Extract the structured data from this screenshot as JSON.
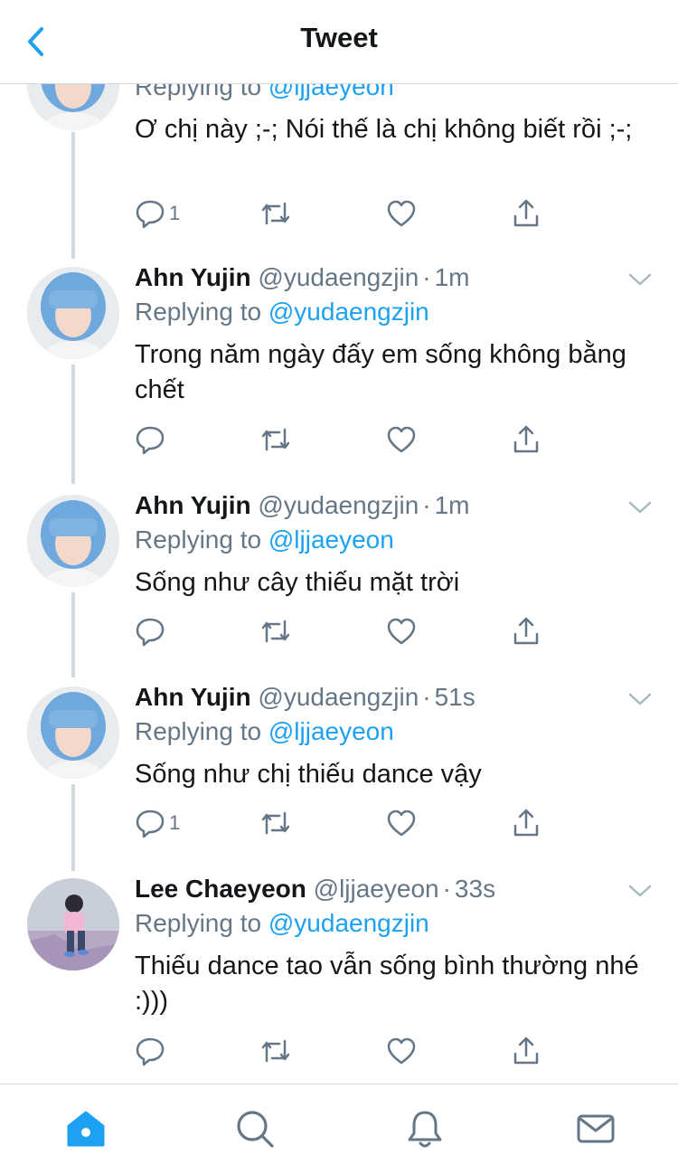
{
  "header": {
    "title": "Tweet",
    "back_icon": "chevron-left-icon"
  },
  "tweets": [
    {
      "name": "",
      "handle": "",
      "time": "",
      "replying_prefix": "Replying to ",
      "replying_to": "@ljjaeyeon",
      "text": "Ơ chị này ;-; Nói thế là chị không biết rồi ;-;",
      "reply_count": "1"
    },
    {
      "name": "Ahn Yujin",
      "handle": "@yudaengzjin",
      "separator": "·",
      "time": "1m",
      "replying_prefix": "Replying to ",
      "replying_to": "@yudaengzjin",
      "text": "Trong năm ngày đấy em sống không bằng chết",
      "reply_count": ""
    },
    {
      "name": "Ahn Yujin",
      "handle": "@yudaengzjin",
      "separator": "·",
      "time": "1m",
      "replying_prefix": "Replying to ",
      "replying_to": "@ljjaeyeon",
      "text": "Sống như cây thiếu mặt trời",
      "reply_count": ""
    },
    {
      "name": "Ahn Yujin",
      "handle": "@yudaengzjin",
      "separator": "·",
      "time": "51s",
      "replying_prefix": "Replying to ",
      "replying_to": "@ljjaeyeon",
      "text": "Sống như chị thiếu dance vậy",
      "reply_count": "1"
    },
    {
      "name": "Lee Chaeyeon",
      "handle": "@ljjaeyeon",
      "separator": "·",
      "time": "33s",
      "replying_prefix": "Replying to ",
      "replying_to": "@yudaengzjin",
      "text": "Thiếu dance tao vẫn sống bình thường nhé :)))",
      "reply_count": ""
    }
  ],
  "tabs": [
    {
      "name": "home",
      "icon": "home-icon",
      "active": true
    },
    {
      "name": "search",
      "icon": "search-icon",
      "active": false
    },
    {
      "name": "notifications",
      "icon": "bell-icon",
      "active": false
    },
    {
      "name": "messages",
      "icon": "mail-icon",
      "active": false
    }
  ],
  "colors": {
    "accent": "#1da1f2",
    "text": "#14171a",
    "secondary": "#657786",
    "divider": "#cfd9de"
  }
}
